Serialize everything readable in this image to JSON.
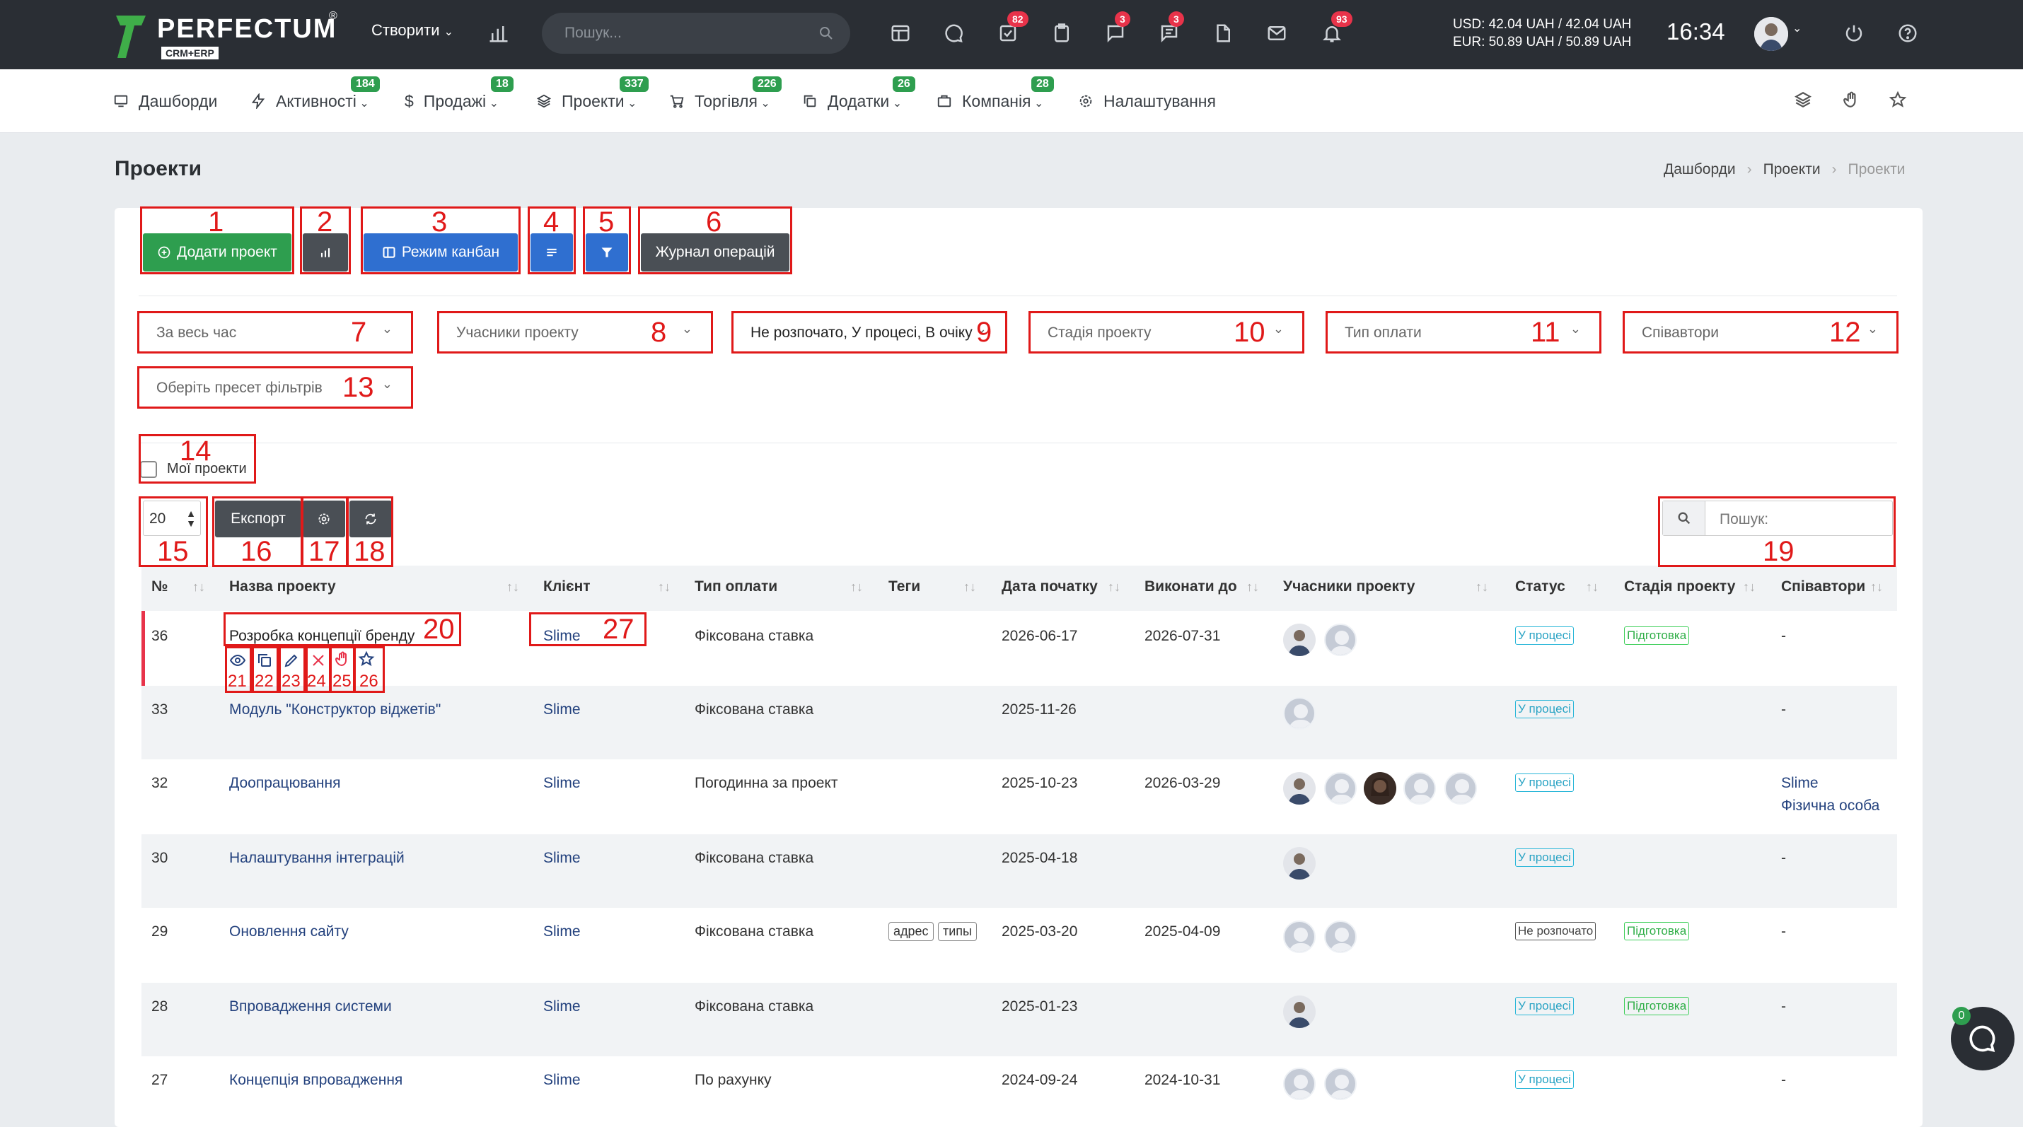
{
  "app": {
    "logo_text": "PERFECTUM",
    "logo_reg": "®",
    "logo_sub": "CRM+ERP"
  },
  "topbar": {
    "create_label": "Створити",
    "search_placeholder": "Пошук...",
    "badges": {
      "tasks": "82",
      "chat": "3",
      "comments": "3",
      "notifications": "93"
    },
    "currency_usd": "USD: 42.04 UAH / 42.04 UAH",
    "currency_eur": "EUR: 50.89 UAH / 50.89 UAH",
    "time": "16:34"
  },
  "nav": {
    "items": [
      {
        "label": "Дашборди",
        "badge": ""
      },
      {
        "label": "Активності",
        "badge": "184"
      },
      {
        "label": "Продажі",
        "badge": "18"
      },
      {
        "label": "Проекти",
        "badge": "337"
      },
      {
        "label": "Торгівля",
        "badge": "226"
      },
      {
        "label": "Додатки",
        "badge": "26"
      },
      {
        "label": "Компанія",
        "badge": "28"
      },
      {
        "label": "Налаштування",
        "badge": ""
      }
    ]
  },
  "page": {
    "title": "Проекти",
    "breadcrumb": [
      "Дашборди",
      "Проекти",
      "Проекти"
    ]
  },
  "toolbar": {
    "add_label": "Додати проект",
    "kanban_label": "Режим канбан",
    "journal_label": "Журнал операцій"
  },
  "filters": {
    "period": "За весь час",
    "participants": "Учасники проекту",
    "status": "Не розпочато, У процесі, В очіку",
    "stage": "Стадія проекту",
    "payment": "Тип оплати",
    "executors": "Співавтори",
    "preset": "Оберіть пресет фільтрів",
    "my_projects": "Мої проекти"
  },
  "table_controls": {
    "page_size": "20",
    "export_label": "Експорт",
    "search_label": "Пошук:"
  },
  "table": {
    "headers": [
      "№",
      "Назва проекту",
      "Клієнт",
      "Тип оплати",
      "Теги",
      "Дата початку",
      "Виконати до",
      "Учасники проекту",
      "Статус",
      "Стадія проекту",
      "Співавтори"
    ],
    "rows": [
      {
        "id": "36",
        "name": "Розробка концепції бренду",
        "client": "Slime",
        "payment": "Фіксована ставка",
        "tags": [],
        "start": "2026-06-17",
        "due": "2026-07-31",
        "status": "У процесі",
        "stage": "Підготовка",
        "coauthors": [
          "-"
        ]
      },
      {
        "id": "33",
        "name": "Модуль \"Конструктор віджетів\"",
        "client": "Slime",
        "payment": "Фіксована ставка",
        "tags": [],
        "start": "2025-11-26",
        "due": "",
        "status": "У процесі",
        "stage": "",
        "coauthors": [
          "-"
        ]
      },
      {
        "id": "32",
        "name": "Доопрацювання",
        "client": "Slime",
        "payment": "Погодинна за проект",
        "tags": [],
        "start": "2025-10-23",
        "due": "2026-03-29",
        "status": "У процесі",
        "stage": "",
        "coauthors": [
          "Slime",
          "Фізична особа"
        ]
      },
      {
        "id": "30",
        "name": "Налаштування інтеграцій",
        "client": "Slime",
        "payment": "Фіксована ставка",
        "tags": [],
        "start": "2025-04-18",
        "due": "",
        "status": "У процесі",
        "stage": "",
        "coauthors": [
          "-"
        ]
      },
      {
        "id": "29",
        "name": "Оновлення сайту",
        "client": "Slime",
        "payment": "Фіксована ставка",
        "tags": [
          "адрес",
          "типы"
        ],
        "start": "2025-03-20",
        "due": "2025-04-09",
        "status": "Не розпочато",
        "stage": "Підготовка",
        "coauthors": [
          "-"
        ]
      },
      {
        "id": "28",
        "name": "Впровадження системи",
        "client": "Slime",
        "payment": "Фіксована ставка",
        "tags": [],
        "start": "2025-01-23",
        "due": "",
        "status": "У процесі",
        "stage": "Підготовка",
        "coauthors": [
          "-"
        ]
      },
      {
        "id": "27",
        "name": "Концепція впровадження",
        "client": "Slime",
        "payment": "По рахунку",
        "tags": [],
        "start": "2024-09-24",
        "due": "2024-10-31",
        "status": "У процесі",
        "stage": "",
        "coauthors": [
          "-"
        ]
      }
    ]
  },
  "annotations": [
    "1",
    "2",
    "3",
    "4",
    "5",
    "6",
    "7",
    "8",
    "9",
    "10",
    "11",
    "12",
    "13",
    "14",
    "15",
    "16",
    "17",
    "18",
    "19",
    "20",
    "21",
    "22",
    "23",
    "24",
    "25",
    "26",
    "27"
  ],
  "chat": {
    "badge": "0"
  },
  "colors": {
    "topbar": "#2a2e34",
    "green": "#2e9e4f",
    "blue": "#2f6fd0",
    "dark_btn": "#4a4f55",
    "annotation_red": "#e01919",
    "link": "#24427e"
  }
}
